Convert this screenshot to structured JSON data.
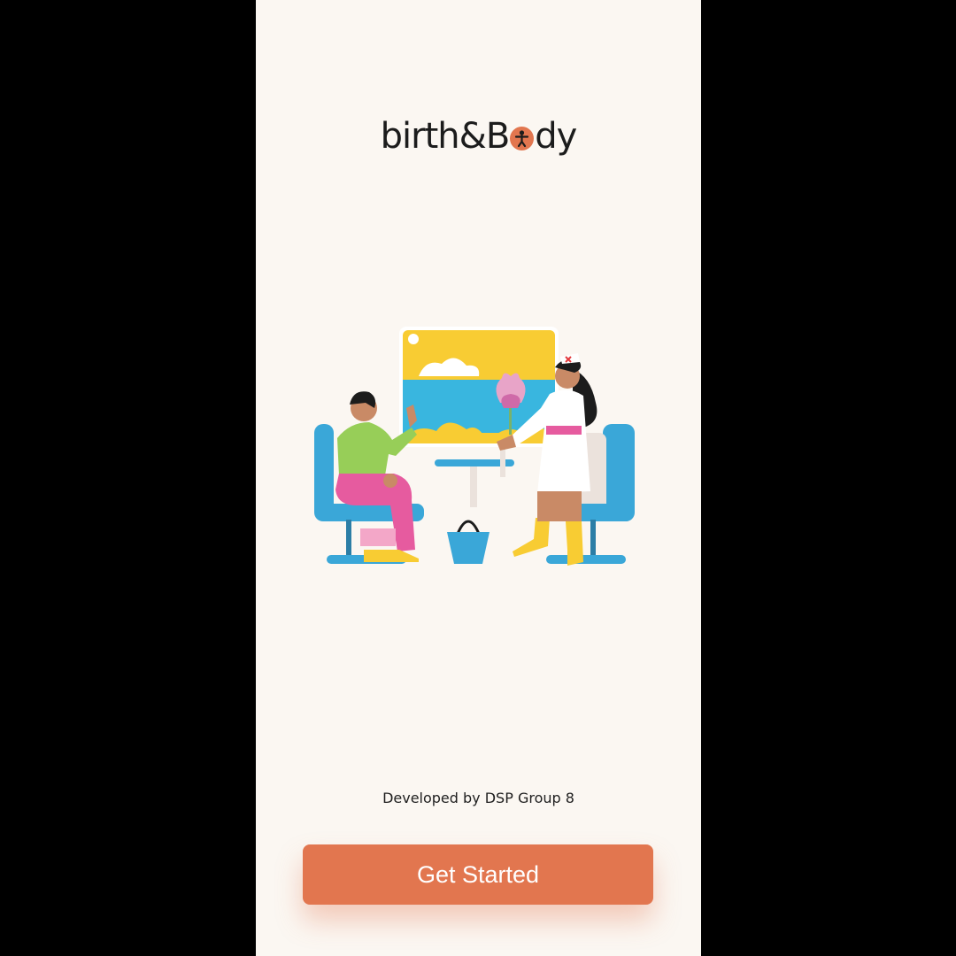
{
  "brand": {
    "logo_part1": "b",
    "logo_part2": "irth&B",
    "logo_part3": "dy",
    "accent_color": "#e2764f"
  },
  "illustration": {
    "icon": "consultation-illustration"
  },
  "footer": {
    "credit": "Developed by DSP Group 8"
  },
  "cta": {
    "label": "Get Started"
  },
  "colors": {
    "background": "#fbf7f2",
    "button": "#e2764f",
    "outer": "#000000"
  }
}
